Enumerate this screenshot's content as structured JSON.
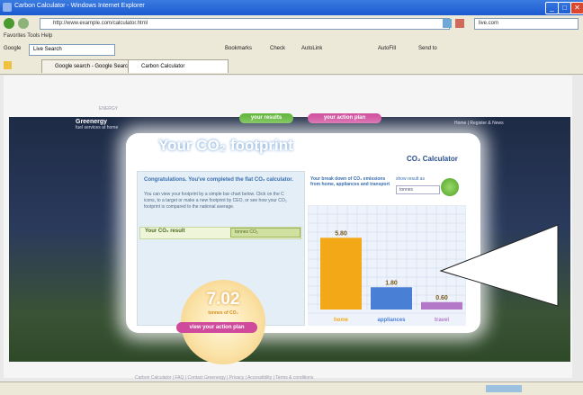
{
  "window": {
    "title": "Carbon Calculator - Windows Internet Explorer",
    "min": "_",
    "max": "□",
    "close": "✕"
  },
  "browser": {
    "address": "http://www.example.com/calculator.html",
    "web_search": "live.com",
    "menu_text": "Favorites Tools Help",
    "google_search": "Live Search",
    "toolbar_items": [
      "Bookmarks",
      "Check",
      "AutoLink",
      "AutoFill",
      "Send to"
    ],
    "tabs": [
      "Google search - Google Search",
      "Carbon Calculator"
    ]
  },
  "page": {
    "brand": "Greenergy",
    "brand_tagline": "fuel services at home",
    "header_small": "ENERGY",
    "top_links": "Home | Register & News",
    "tab_results": "your results",
    "tab_action": "your action plan",
    "headline": "Your CO₂ footprint",
    "logo": "CO₂ Calculator",
    "congrats": "Congratulations. You've completed the flat CO₂ calculator.",
    "description": "You can view your footprint by a simple bar chart below. Click on the C icons, to a target or make a new footprint by CEO, or see how your CO₂ footprint is compared to the national average.",
    "result_label": "Your CO₂ result",
    "result_select": "tonnes CO₂",
    "big_value": "7.02",
    "big_unit": "tonnes of CO₂",
    "action_button": "view your action plan",
    "right_title": "Your break down of CO₂ emissions from home, appliances and transport",
    "result_for": "show result as",
    "select_value": "tonnes",
    "footer": "Carbon Calculator | FAQ | Contact Greenergy | Privacy | Accessibility | Terms & conditions"
  },
  "chart_data": {
    "type": "bar",
    "categories": [
      "home",
      "appliances",
      "travel"
    ],
    "values": [
      5.8,
      1.8,
      0.6
    ],
    "labels": [
      "5.80",
      "1.80",
      "0.60"
    ],
    "colors": [
      "#f3a817",
      "#4a7fd6",
      "#b478c8"
    ],
    "ylim": [
      0,
      8
    ],
    "grid": true
  },
  "colors": {
    "accent_green": "#5db534",
    "accent_pink": "#d04a9b"
  }
}
